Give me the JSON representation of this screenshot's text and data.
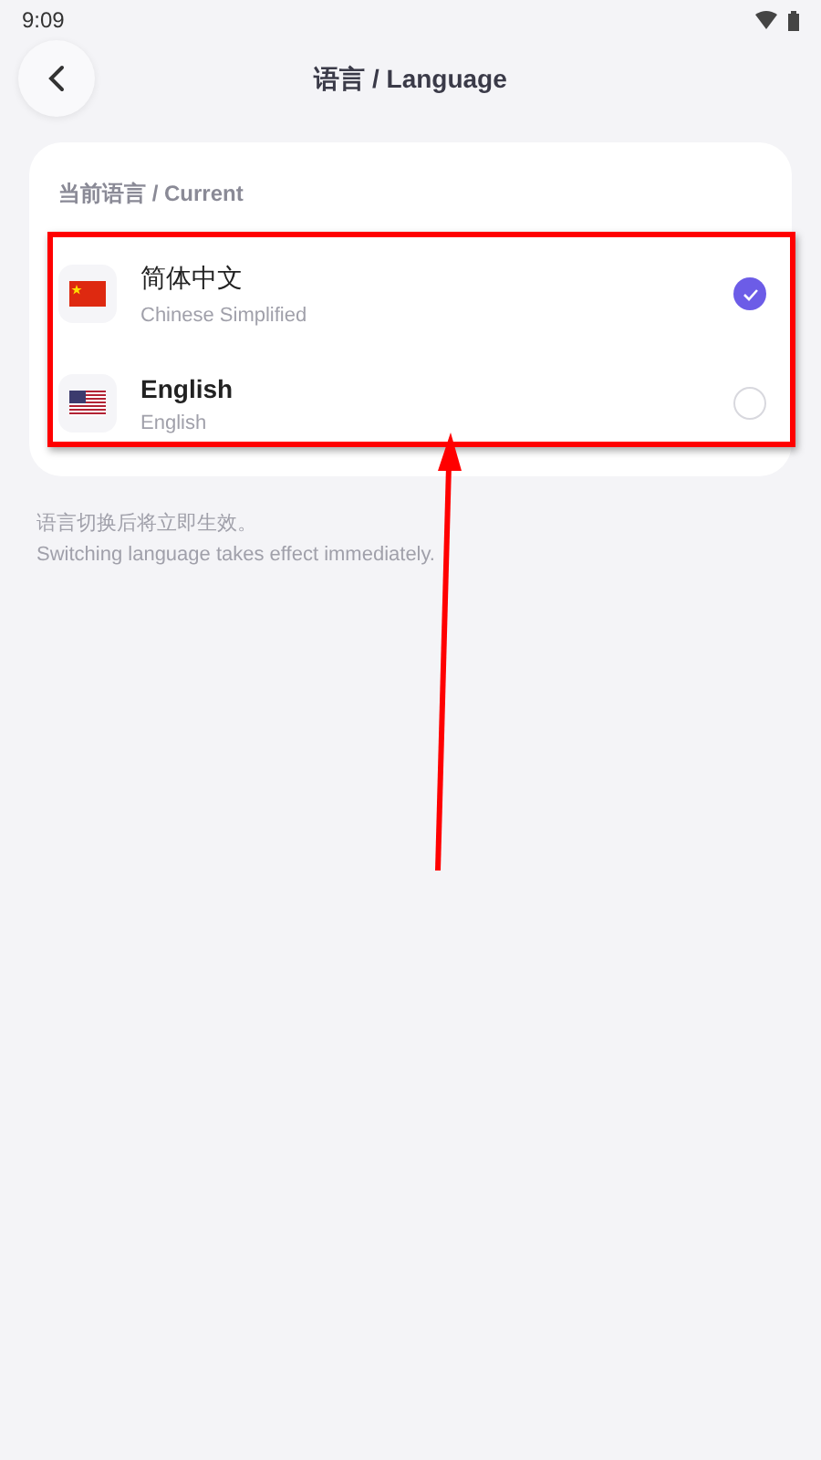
{
  "status_bar": {
    "time": "9:09"
  },
  "header": {
    "title": "语言 / Language"
  },
  "section": {
    "title": "当前语言 / Current",
    "languages": [
      {
        "kind": "cn",
        "name": "简体中文",
        "subtitle": "Chinese Simplified",
        "selected": true
      },
      {
        "kind": "us",
        "name": "English",
        "subtitle": "English",
        "selected": false
      }
    ]
  },
  "note": {
    "line_1": "语言切换后将立即生效。",
    "line_2": "Switching language takes effect immediately."
  }
}
